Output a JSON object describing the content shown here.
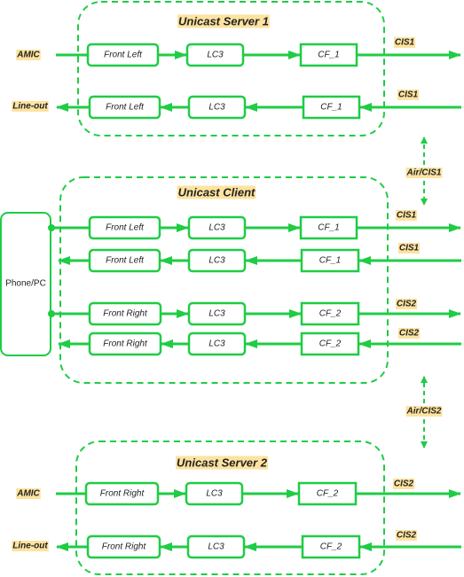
{
  "colors": {
    "accent": "#1fcc45",
    "label_bg": "#fde3a0",
    "text": "#222222"
  },
  "groups": [
    {
      "title": "Unicast Server 1",
      "rows": [
        {
          "direction": "out",
          "side_label": "AMIC",
          "blocks": [
            "Front Left",
            "LC3",
            "CF_1"
          ],
          "link_label": "CIS1"
        },
        {
          "direction": "in",
          "side_label": "Line-out",
          "blocks": [
            "Front Left",
            "LC3",
            "CF_1"
          ],
          "link_label": "CIS1"
        }
      ]
    },
    {
      "title": "Unicast Client",
      "rows": [
        {
          "direction": "out",
          "blocks": [
            "Front Left",
            "LC3",
            "CF_1"
          ],
          "link_label": "CIS1"
        },
        {
          "direction": "in",
          "blocks": [
            "Front Left",
            "LC3",
            "CF_1"
          ],
          "link_label": "CIS1"
        },
        {
          "direction": "out",
          "blocks": [
            "Front Right",
            "LC3",
            "CF_2"
          ],
          "link_label": "CIS2"
        },
        {
          "direction": "in",
          "blocks": [
            "Front Right",
            "LC3",
            "CF_2"
          ],
          "link_label": "CIS2"
        }
      ]
    },
    {
      "title": "Unicast Server 2",
      "rows": [
        {
          "direction": "out",
          "side_label": "AMIC",
          "blocks": [
            "Front  Right",
            "LC3",
            "CF_2"
          ],
          "link_label": "CIS2"
        },
        {
          "direction": "in",
          "side_label": "Line-out",
          "blocks": [
            "Front Right",
            "LC3",
            "CF_2"
          ],
          "link_label": "CIS2"
        }
      ]
    }
  ],
  "host": {
    "label": "Phone/PC"
  },
  "air_links": [
    "Air/CIS1",
    "Air/CIS2"
  ]
}
